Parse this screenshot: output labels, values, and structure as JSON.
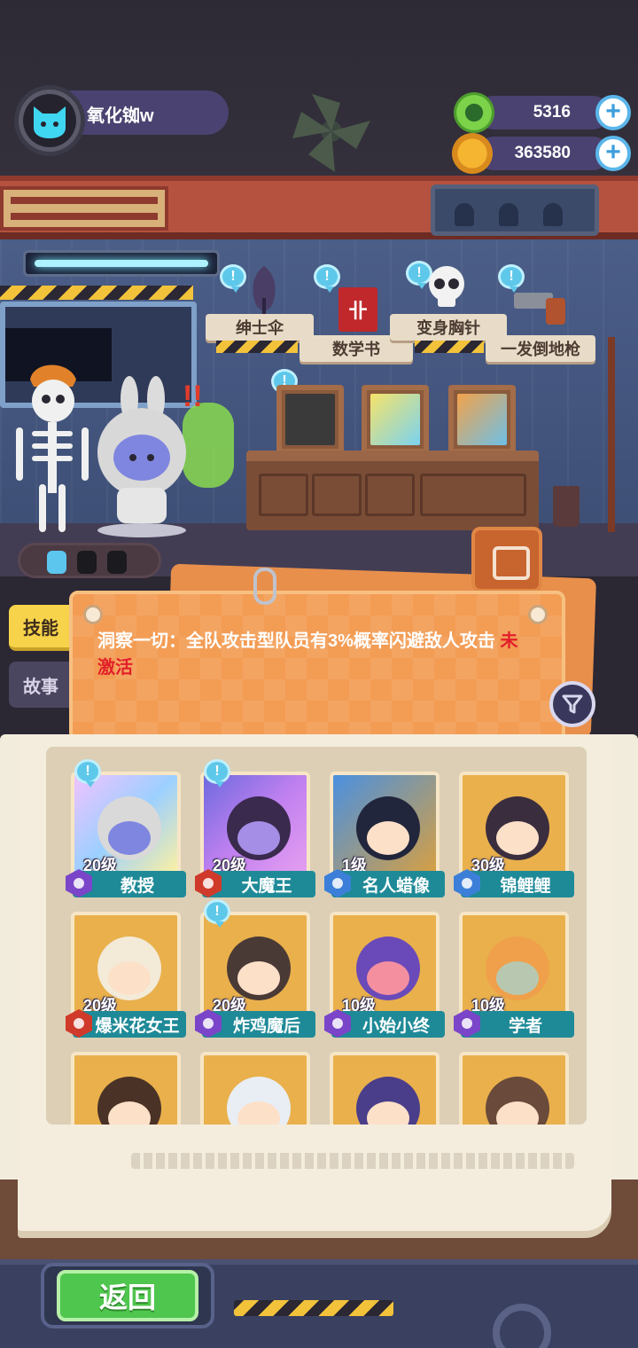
{
  "player": {
    "name": "氧化铷w"
  },
  "currency": [
    {
      "id": "gems",
      "value": "5316",
      "color": "#7cd34a"
    },
    {
      "id": "coins",
      "value": "363580",
      "color": "#f6a531"
    }
  ],
  "equipment": [
    {
      "label": "绅士伞"
    },
    {
      "label": "数学书"
    },
    {
      "label": "变身胸针"
    },
    {
      "label": "一发倒地枪"
    }
  ],
  "tabs": [
    {
      "label": "技能",
      "active": true
    },
    {
      "label": "故事",
      "active": false
    }
  ],
  "skill": {
    "description": "洞察一切：全队攻击型队员有3%概率闪避敌人攻击",
    "status": "未激活",
    "status_color": "#e21f2a"
  },
  "characters": [
    {
      "level": "20级",
      "name": "教授",
      "badge": "purple",
      "alert": true
    },
    {
      "level": "20级",
      "name": "大魔王",
      "badge": "red",
      "alert": true
    },
    {
      "level": "1级",
      "name": "名人蜡像",
      "badge": "blue",
      "alert": false
    },
    {
      "level": "30级",
      "name": "锦鲤鲤",
      "badge": "blue",
      "alert": false
    },
    {
      "level": "20级",
      "name": "爆米花女王",
      "badge": "red",
      "alert": false
    },
    {
      "level": "20级",
      "name": "炸鸡魔后",
      "badge": "purple",
      "alert": true
    },
    {
      "level": "10级",
      "name": "小始小终",
      "badge": "purple",
      "alert": false
    },
    {
      "level": "10级",
      "name": "学者",
      "badge": "purple",
      "alert": false
    },
    {
      "level": "",
      "name": "",
      "badge": "",
      "alert": false
    },
    {
      "level": "",
      "name": "",
      "badge": "",
      "alert": false
    },
    {
      "level": "",
      "name": "",
      "badge": "",
      "alert": false
    },
    {
      "level": "",
      "name": "",
      "badge": "",
      "alert": false
    }
  ],
  "buttons": {
    "back": "返回"
  }
}
